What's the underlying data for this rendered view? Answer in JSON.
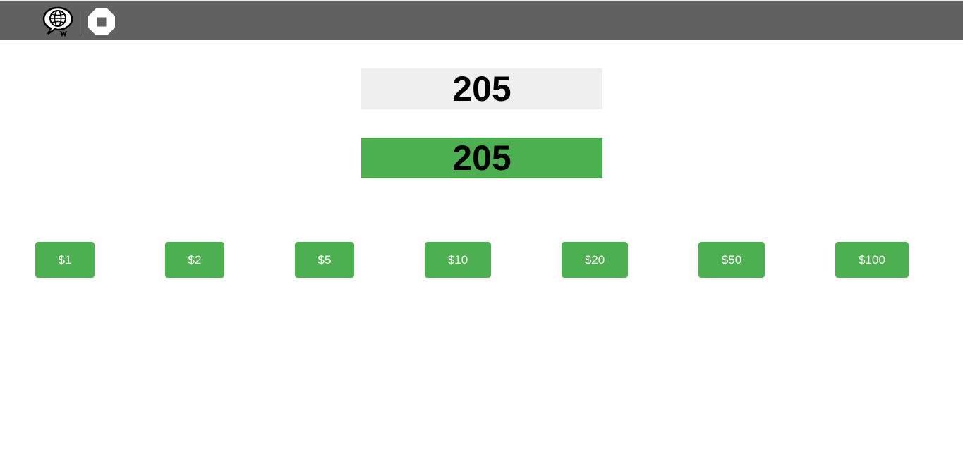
{
  "toolbar": {
    "language_icon": "globe-speech-bubble-icon",
    "stop_icon": "stop-octagon-icon",
    "background_color": "#626162"
  },
  "displays": {
    "target_value": "205",
    "current_value": "205",
    "target_bg": "#efefef",
    "current_bg": "#4caf50"
  },
  "buttons": {
    "accent_color": "#4caf50",
    "items": [
      {
        "label": "$1"
      },
      {
        "label": "$2"
      },
      {
        "label": "$5"
      },
      {
        "label": "$10"
      },
      {
        "label": "$20"
      },
      {
        "label": "$50"
      },
      {
        "label": "$100"
      }
    ]
  }
}
